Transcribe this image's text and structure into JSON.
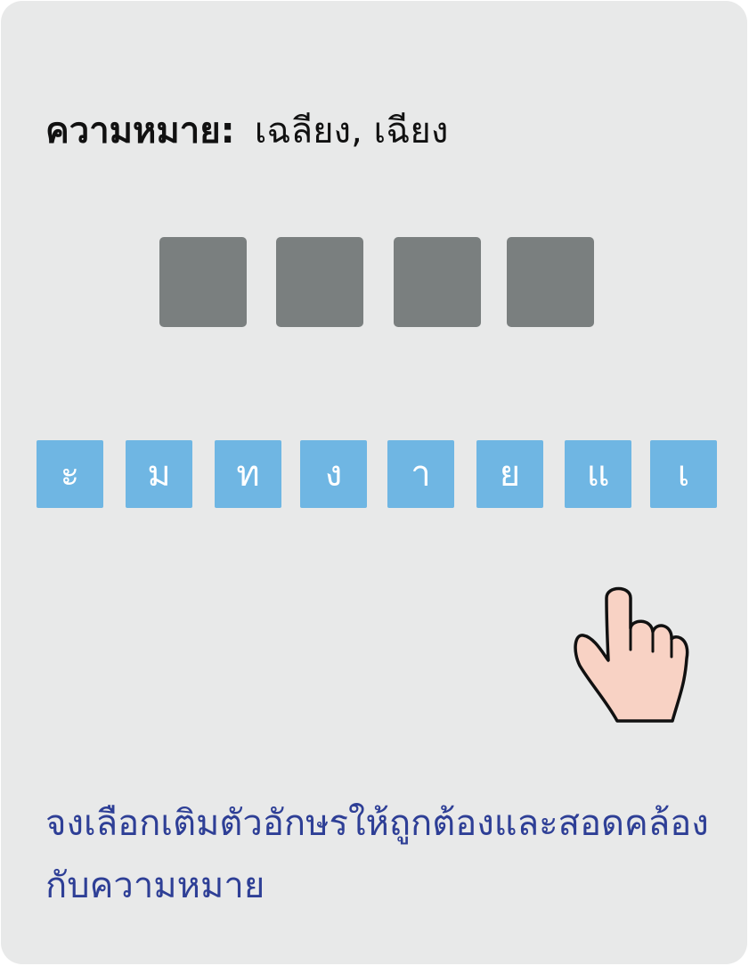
{
  "meaning": {
    "label": "ความหมาย:",
    "value": "เฉลียง, เฉียง"
  },
  "answer_slots": [
    {
      "filled": false
    },
    {
      "filled": false
    },
    {
      "filled": false
    },
    {
      "filled": false
    }
  ],
  "letter_tiles": [
    "ะ",
    "ม",
    "ท",
    "ง",
    "า",
    "ย",
    "แ",
    "เ"
  ],
  "instruction": {
    "line1": "จงเลือกเติมตัวอักษรให้ถูกต้องและสอดคล้อง",
    "line2": "กับความหมาย"
  },
  "colors": {
    "card_background": "#e8e9e9",
    "slot": "#7a7f7f",
    "tile": "#6fb6e3",
    "tile_text": "#ffffff",
    "instruction_text": "#2e3f96",
    "hand_fill": "#f8d2c4"
  },
  "icons": {
    "pointer": "pointing-hand-icon"
  }
}
